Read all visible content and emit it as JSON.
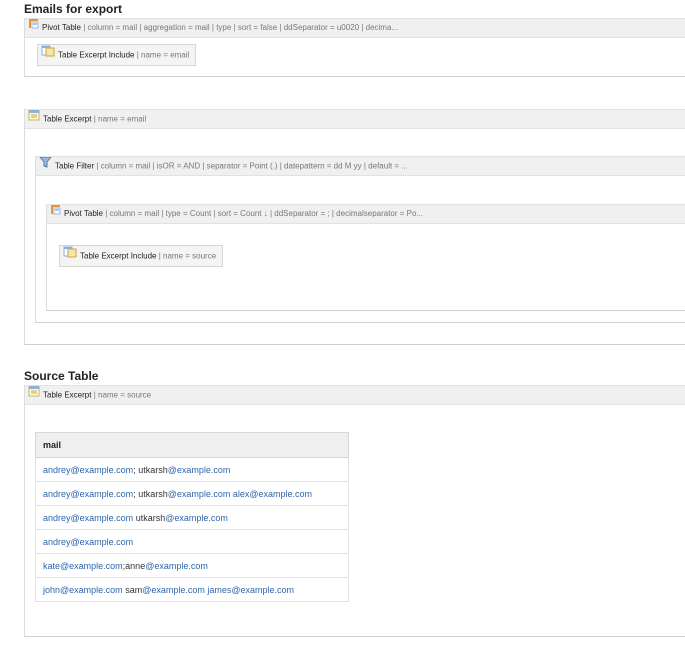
{
  "section1": {
    "title": "Emails for export",
    "pivot": {
      "name": "Pivot Table",
      "params": " | column = mail | aggregation = mail | type | sort = false | ddSeparator = u0020 | decima...",
      "icon": "pivot-table-icon"
    },
    "include": {
      "name": "Table Excerpt Include",
      "params": " | name = email",
      "icon": "table-excerpt-include-icon"
    }
  },
  "section2": {
    "excerpt": {
      "name": "Table Excerpt",
      "params": " | name = email",
      "icon": "table-excerpt-icon"
    },
    "filter": {
      "name": "Table Filter",
      "params": " | column = mail | isOR = AND | separator = Point (.) | datepattern = dd M yy | default = ...",
      "icon": "funnel-filter-icon"
    },
    "pivot": {
      "name": "Pivot Table",
      "params": " | column = mail | type = Count | sort = Count ↓ | ddSeparator = ; | decimalseparator = Po...",
      "icon": "pivot-table-icon"
    },
    "include": {
      "name": "Table Excerpt Include",
      "params": " | name = source",
      "icon": "table-excerpt-include-icon"
    }
  },
  "section3": {
    "title": "Source Table",
    "excerpt": {
      "name": "Table Excerpt",
      "params": " | name = source",
      "icon": "table-excerpt-icon"
    },
    "table": {
      "header": "mail",
      "rows": [
        [
          {
            "t": "andrey@example.com",
            "l": true
          },
          {
            "t": "; ",
            "l": false
          },
          {
            "t": "utkarsh",
            "l": false
          },
          {
            "t": "@example.com",
            "l": true
          }
        ],
        [
          {
            "t": "andrey@example.com",
            "l": true
          },
          {
            "t": "; utkarsh",
            "l": false
          },
          {
            "t": "@example.com",
            "l": true
          },
          {
            "t": " ",
            "l": false
          },
          {
            "t": "alex@example.com",
            "l": true
          }
        ],
        [
          {
            "t": "andrey@example.com",
            "l": true
          },
          {
            "t": " utkarsh",
            "l": false
          },
          {
            "t": "@example.com",
            "l": true
          }
        ],
        [
          {
            "t": "andrey@example.com",
            "l": true
          }
        ],
        [
          {
            "t": "kate@example.com",
            "l": true
          },
          {
            "t": ";anne",
            "l": false
          },
          {
            "t": "@example.com",
            "l": true
          }
        ],
        [
          {
            "t": "john@example.com",
            "l": true
          },
          {
            "t": " sam",
            "l": false
          },
          {
            "t": "@example.com",
            "l": true
          },
          {
            "t": " ",
            "l": false
          },
          {
            "t": "james@example.com",
            "l": true
          }
        ]
      ]
    }
  }
}
